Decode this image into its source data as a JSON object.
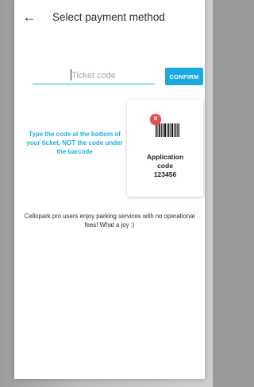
{
  "header": {
    "back_icon": "arrow-left-icon",
    "title": "Select payment method"
  },
  "ticket_form": {
    "placeholder": "Ticket code",
    "value": "",
    "confirm_label": "CONFIRM"
  },
  "hint": {
    "text": "Type the code at the bottom of your ticket, NOT the code under the barcode"
  },
  "app_code_card": {
    "icon": "barcode-icon",
    "badge_icon": "error-x-icon",
    "label_line1": "Application",
    "label_line2": "code",
    "code": "123456"
  },
  "footer": {
    "info_text": "Cellopark pro users enjoy parking services with no operational fees! What a joy :)"
  },
  "colors": {
    "accent": "#1aa9e0",
    "hint_text": "#1fb0e2",
    "error": "#e64a4a"
  }
}
